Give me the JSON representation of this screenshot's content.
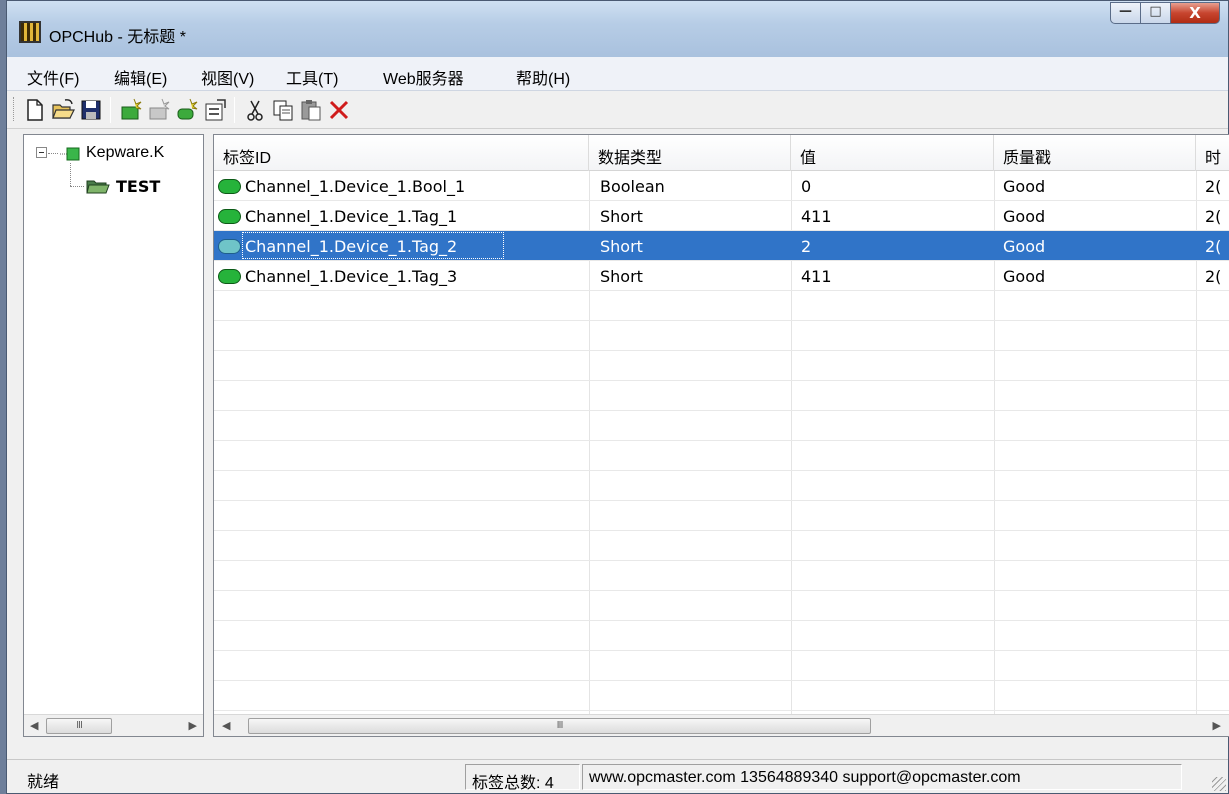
{
  "window": {
    "title": "OPCHub - 无标题 *"
  },
  "caption": {
    "minimize": "—",
    "maximize": "□",
    "close": "X"
  },
  "menubar": {
    "items": [
      "文件(F)",
      "编辑(E)",
      "视图(V)",
      "工具(T)",
      "Web服务器",
      "帮助(H)"
    ]
  },
  "toolbar": {
    "buttons": [
      "new-icon",
      "open-icon",
      "save-icon",
      "new-server-icon",
      "new-group-icon",
      "new-tag-icon",
      "properties-icon",
      "cut-icon",
      "copy-icon",
      "paste-icon",
      "delete-icon"
    ]
  },
  "tree": {
    "root": "Kepware.K",
    "child": "TEST"
  },
  "list": {
    "columns": [
      "标签ID",
      "数据类型",
      "值",
      "质量戳",
      "时"
    ],
    "rows": [
      {
        "id": "Channel_1.Device_1.Bool_1",
        "type": "Boolean",
        "value": "0",
        "quality": "Good",
        "time": "2("
      },
      {
        "id": "Channel_1.Device_1.Tag_1",
        "type": "Short",
        "value": "411",
        "quality": "Good",
        "time": "2("
      },
      {
        "id": "Channel_1.Device_1.Tag_2",
        "type": "Short",
        "value": "2",
        "quality": "Good",
        "time": "2("
      },
      {
        "id": "Channel_1.Device_1.Tag_3",
        "type": "Short",
        "value": "411",
        "quality": "Good",
        "time": "2("
      }
    ],
    "selected_index": 2
  },
  "scrollbar": {
    "grip": "III"
  },
  "status": {
    "ready": "就绪",
    "tag_count": "标签总数: 4",
    "contact": "www.opcmaster.com 13564889340 support@opcmaster.com"
  },
  "colors": {
    "selection": "#3074c8",
    "tag_icon": "#26b33b"
  }
}
